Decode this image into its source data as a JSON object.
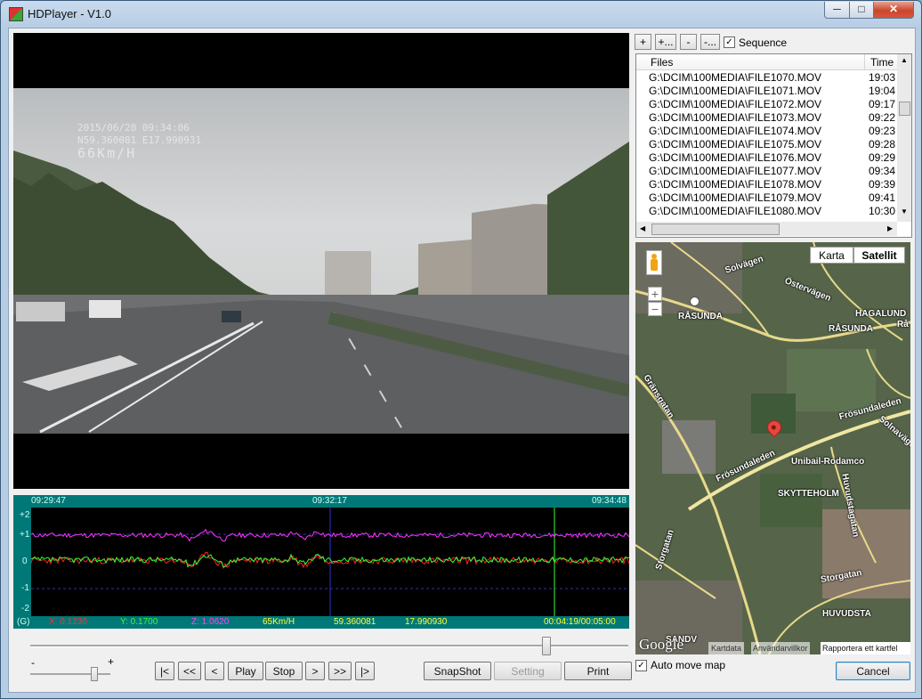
{
  "window": {
    "title": "HDPlayer - V1.0",
    "minimize": "─",
    "maximize": "□",
    "close": "✕"
  },
  "video": {
    "osd_line1": "2015/06/20 09:34:06",
    "osd_line2": "N59.360081 E17.990931",
    "osd_speed": "66Km/H"
  },
  "graph": {
    "time_start": "09:29:47",
    "time_mid": "09:32:17",
    "time_end": "09:34:48",
    "scale": [
      "+2",
      "+1",
      "0",
      "-1",
      "-2"
    ],
    "unit": "(G)",
    "x_label": "X: 0.1230",
    "y_label": "Y: 0.1700",
    "z_label": "Z: 1.0620",
    "speed": "65Km/H",
    "lat": "59.360081",
    "lon": "17.990930",
    "position": "00:04:19/00:05:00",
    "colors": {
      "x": "#ff2020",
      "y": "#33ff33",
      "z": "#ff33ff",
      "background": "#000000",
      "bar": "#007878"
    }
  },
  "volume": {
    "minus": "-",
    "plus": "+"
  },
  "transport": {
    "first": "|<",
    "rewind": "<<",
    "prev": "<",
    "play": "Play",
    "stop": "Stop",
    "next": ">",
    "forward": ">>",
    "last": "|>"
  },
  "actions": {
    "snapshot": "SnapShot",
    "setting": "Setting",
    "print": "Print",
    "cancel": "Cancel"
  },
  "playlist": {
    "add": "+",
    "add_many": "+...",
    "remove": "-",
    "remove_many": "-...",
    "sequence_label": "Sequence",
    "sequence_checked": true,
    "col_files": "Files",
    "col_time": "Time",
    "rows": [
      {
        "file": "G:\\DCIM\\100MEDIA\\FILE1070.MOV",
        "time": "19:03"
      },
      {
        "file": "G:\\DCIM\\100MEDIA\\FILE1071.MOV",
        "time": "19:04"
      },
      {
        "file": "G:\\DCIM\\100MEDIA\\FILE1072.MOV",
        "time": "09:17"
      },
      {
        "file": "G:\\DCIM\\100MEDIA\\FILE1073.MOV",
        "time": "09:22"
      },
      {
        "file": "G:\\DCIM\\100MEDIA\\FILE1074.MOV",
        "time": "09:23"
      },
      {
        "file": "G:\\DCIM\\100MEDIA\\FILE1075.MOV",
        "time": "09:28"
      },
      {
        "file": "G:\\DCIM\\100MEDIA\\FILE1076.MOV",
        "time": "09:29"
      },
      {
        "file": "G:\\DCIM\\100MEDIA\\FILE1077.MOV",
        "time": "09:34"
      },
      {
        "file": "G:\\DCIM\\100MEDIA\\FILE1078.MOV",
        "time": "09:39"
      },
      {
        "file": "G:\\DCIM\\100MEDIA\\FILE1079.MOV",
        "time": "09:41"
      },
      {
        "file": "G:\\DCIM\\100MEDIA\\FILE1080.MOV",
        "time": "10:30"
      }
    ]
  },
  "map": {
    "type_map": "Karta",
    "type_satellite": "Satellit",
    "zoom_in": "+",
    "zoom_out": "−",
    "labels": {
      "solvagen": "Solvägen",
      "ostervagen": "Östervägen",
      "rasunda1": "RÅSUNDA",
      "rasunda2": "RÅSUNDA",
      "hagalund": "HAGALUND",
      "rasunda3": "Rå",
      "gransgatan": "Gränsgatan",
      "frosundaleden1": "Frösundaleden",
      "solnavagen": "Solnavägen",
      "frosundaleden2": "Frösundaleden",
      "unibail": "Unibail-Rodamco",
      "skytteholm": "SKYTTEHOLM",
      "huvudstagatan": "Huvudstagatan",
      "storgatan1": "Storgatan",
      "storgatan2": "Storgatan",
      "huvudsta": "HUVUDSTA",
      "sandv": "SANDV"
    },
    "google": "Google",
    "kartdata": "Kartdata",
    "anvandarvillkor": "Användarvillkor",
    "rapportera": "Rapportera ett kartfel",
    "auto_move_label": "Auto move map",
    "auto_move_checked": true
  }
}
